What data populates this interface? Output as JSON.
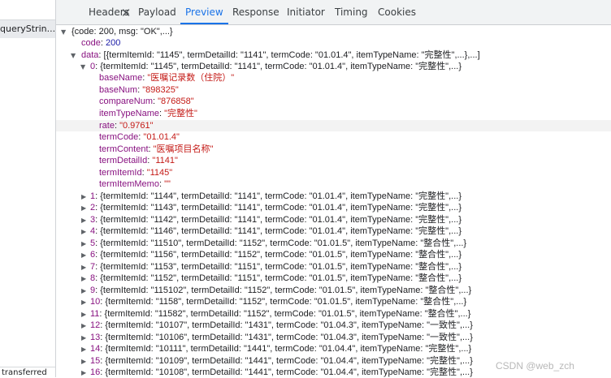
{
  "left_pane": {
    "item": "queryStrin...",
    "status": "transferred"
  },
  "tabs": [
    "Headers",
    "Payload",
    "Preview",
    "Response",
    "Initiator",
    "Timing",
    "Cookies"
  ],
  "active_tab": "Preview",
  "close_glyph": "✕",
  "tree": {
    "root_summary": "{code: 200, msg: \"OK\",...}",
    "code_key": "code",
    "code_val": "200",
    "data_key": "data",
    "data_summary": "[{termItemId: \"1145\", termDetailId: \"1141\", termCode: \"01.01.4\", itemTypeName: \"完整性\",...},...]",
    "item0_key": "0",
    "item0_summary": "{termItemId: \"1145\", termDetailId: \"1141\", termCode: \"01.01.4\", itemTypeName: \"完整性\",...}",
    "fields": [
      {
        "key": "baseName",
        "val": "\"医嘱记录数（住院）\"",
        "kind": "str"
      },
      {
        "key": "baseNum",
        "val": "\"898325\"",
        "kind": "str"
      },
      {
        "key": "compareNum",
        "val": "\"876858\"",
        "kind": "str"
      },
      {
        "key": "itemTypeName",
        "val": "\"完整性\"",
        "kind": "str"
      },
      {
        "key": "rate",
        "val": "\"0.9761\"",
        "kind": "str"
      },
      {
        "key": "termCode",
        "val": "\"01.01.4\"",
        "kind": "str"
      },
      {
        "key": "termContent",
        "val": "\"医嘱项目名称\"",
        "kind": "str"
      },
      {
        "key": "termDetailId",
        "val": "\"1141\"",
        "kind": "str"
      },
      {
        "key": "termItemId",
        "val": "\"1145\"",
        "kind": "str"
      },
      {
        "key": "termItemMemo",
        "val": "\"\"",
        "kind": "str"
      }
    ],
    "items": [
      {
        "key": "1",
        "summary": "{termItemId: \"1144\", termDetailId: \"1141\", termCode: \"01.01.4\", itemTypeName: \"完整性\",...}"
      },
      {
        "key": "2",
        "summary": "{termItemId: \"1143\", termDetailId: \"1141\", termCode: \"01.01.4\", itemTypeName: \"完整性\",...}"
      },
      {
        "key": "3",
        "summary": "{termItemId: \"1142\", termDetailId: \"1141\", termCode: \"01.01.4\", itemTypeName: \"完整性\",...}"
      },
      {
        "key": "4",
        "summary": "{termItemId: \"1146\", termDetailId: \"1141\", termCode: \"01.01.4\", itemTypeName: \"完整性\",...}"
      },
      {
        "key": "5",
        "summary": "{termItemId: \"11510\", termDetailId: \"1152\", termCode: \"01.01.5\", itemTypeName: \"整合性\",...}"
      },
      {
        "key": "6",
        "summary": "{termItemId: \"1156\", termDetailId: \"1152\", termCode: \"01.01.5\", itemTypeName: \"整合性\",...}"
      },
      {
        "key": "7",
        "summary": "{termItemId: \"1153\", termDetailId: \"1151\", termCode: \"01.01.5\", itemTypeName: \"整合性\",...}"
      },
      {
        "key": "8",
        "summary": "{termItemId: \"1152\", termDetailId: \"1151\", termCode: \"01.01.5\", itemTypeName: \"整合性\",...}"
      },
      {
        "key": "9",
        "summary": "{termItemId: \"115102\", termDetailId: \"1152\", termCode: \"01.01.5\", itemTypeName: \"整合性\",...}"
      },
      {
        "key": "10",
        "summary": "{termItemId: \"1158\", termDetailId: \"1152\", termCode: \"01.01.5\", itemTypeName: \"整合性\",...}"
      },
      {
        "key": "11",
        "summary": "{termItemId: \"11582\", termDetailId: \"1152\", termCode: \"01.01.5\", itemTypeName: \"整合性\",...}"
      },
      {
        "key": "12",
        "summary": "{termItemId: \"10107\", termDetailId: \"1431\", termCode: \"01.04.3\", itemTypeName: \"一致性\",...}"
      },
      {
        "key": "13",
        "summary": "{termItemId: \"10106\", termDetailId: \"1431\", termCode: \"01.04.3\", itemTypeName: \"一致性\",...}"
      },
      {
        "key": "14",
        "summary": "{termItemId: \"10111\", termDetailId: \"1441\", termCode: \"01.04.4\", itemTypeName: \"完整性\",...}"
      },
      {
        "key": "15",
        "summary": "{termItemId: \"10109\", termDetailId: \"1441\", termCode: \"01.04.4\", itemTypeName: \"完整性\",...}"
      },
      {
        "key": "16",
        "summary": "{termItemId: \"10108\", termDetailId: \"1441\", termCode: \"01.04.4\", itemTypeName: \"完整性\",...}"
      }
    ]
  },
  "watermark": "CSDN @web_zch",
  "colors": {
    "key": "#881280",
    "string": "#c41a16",
    "number": "#1a1aa6",
    "active_tab": "#1a73e8"
  }
}
